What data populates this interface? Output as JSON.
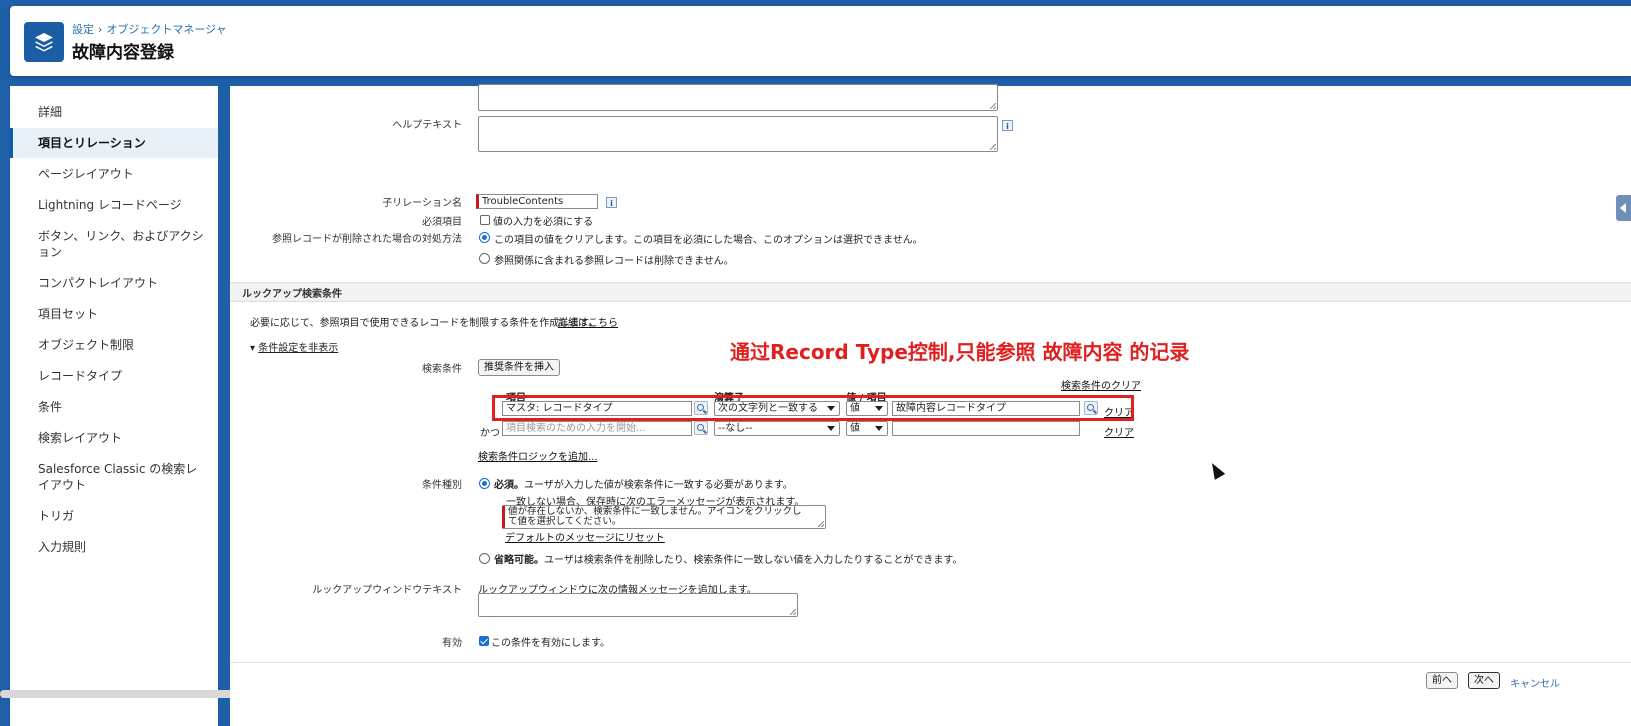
{
  "header": {
    "breadcrumb": [
      "設定",
      "オブジェクトマネージャ"
    ],
    "breadcrumb_sep": "›",
    "title": "故障内容登録",
    "icon": "layers-icon"
  },
  "sidebar": {
    "items": [
      {
        "label": "詳細"
      },
      {
        "label": "項目とリレーション",
        "active": true
      },
      {
        "label": "ページレイアウト"
      },
      {
        "label": "Lightning レコードページ"
      },
      {
        "label": "ボタン、リンク、およびアクション"
      },
      {
        "label": "コンパクトレイアウト"
      },
      {
        "label": "項目セット"
      },
      {
        "label": "オブジェクト制限"
      },
      {
        "label": "レコードタイプ"
      },
      {
        "label": "条件"
      },
      {
        "label": "検索レイアウト"
      },
      {
        "label": "Salesforce Classic の検索レイアウト"
      },
      {
        "label": "トリガ"
      },
      {
        "label": "入力規則"
      }
    ]
  },
  "form": {
    "help_text_label": "ヘルプテキスト",
    "child_relation_label": "子リレーション名",
    "child_relation_value": "TroubleContents",
    "required_label": "必須項目",
    "required_checkbox_text": "値の入力を必須にする",
    "on_delete_label": "参照レコードが削除された場合の対処方法",
    "on_delete_option1": "この項目の値をクリアします。この項目を必須にした場合、このオプションは選択できません。",
    "on_delete_option2": "参照関係に含まれる参照レコードは削除できません。"
  },
  "lookup_filter": {
    "section_title": "ルックアップ検索条件",
    "description": "必要に応じて、参照項目で使用できるレコードを制限する条件を作成します。",
    "details_link": "詳細はこちら",
    "toggle_link": "条件設定を非表示",
    "criteria_label": "検索条件",
    "insert_button": "推奨条件を挿入",
    "clear_filter_link": "検索条件のクリア",
    "col_field": "項目",
    "col_operator": "演算子",
    "col_value": "値 / 項目",
    "row1": {
      "field": "マスタ: レコードタイプ",
      "operator": "次の文字列と一致する",
      "value_type": "値",
      "value": "故障内容レコードタイプ",
      "clear": "クリア"
    },
    "row2": {
      "prefix": "かつ",
      "field_placeholder": "項目検索のための入力を開始...",
      "operator": "--なし--",
      "value_type": "値",
      "value": "",
      "clear": "クリア"
    },
    "add_logic_link": "検索条件ロジックを追加...",
    "type_label": "条件種別",
    "required_bold": "必須。",
    "required_text": "ユーザが入力した値が検索条件に一致する必要があります。",
    "error_intro": "一致しない場合、保存時に次のエラーメッセージが表示されます。",
    "error_message": "値が存在しないか、検索条件に一致しません。アイコンをクリックして値を選択してください。",
    "reset_link": "デフォルトのメッセージにリセット",
    "optional_bold": "省略可能。",
    "optional_text": "ユーザは検索条件を削除したり、検索条件に一致しない値を入力したりすることができます。",
    "window_text_label": "ルックアップウィンドウテキスト",
    "window_text_intro": "ルックアップウィンドウに次の情報メッセージを追加します。",
    "active_label": "有効",
    "active_text": "この条件を有効にします。"
  },
  "annotation": "通过Record Type控制,只能参照 故障内容 的记录",
  "footer": {
    "prev_button": "前へ",
    "next_button": "次へ",
    "cancel_link": "キャンセル"
  },
  "colors": {
    "accent": "#1b5ea5",
    "annotation": "#e02020",
    "background": "#1f5fa8"
  }
}
